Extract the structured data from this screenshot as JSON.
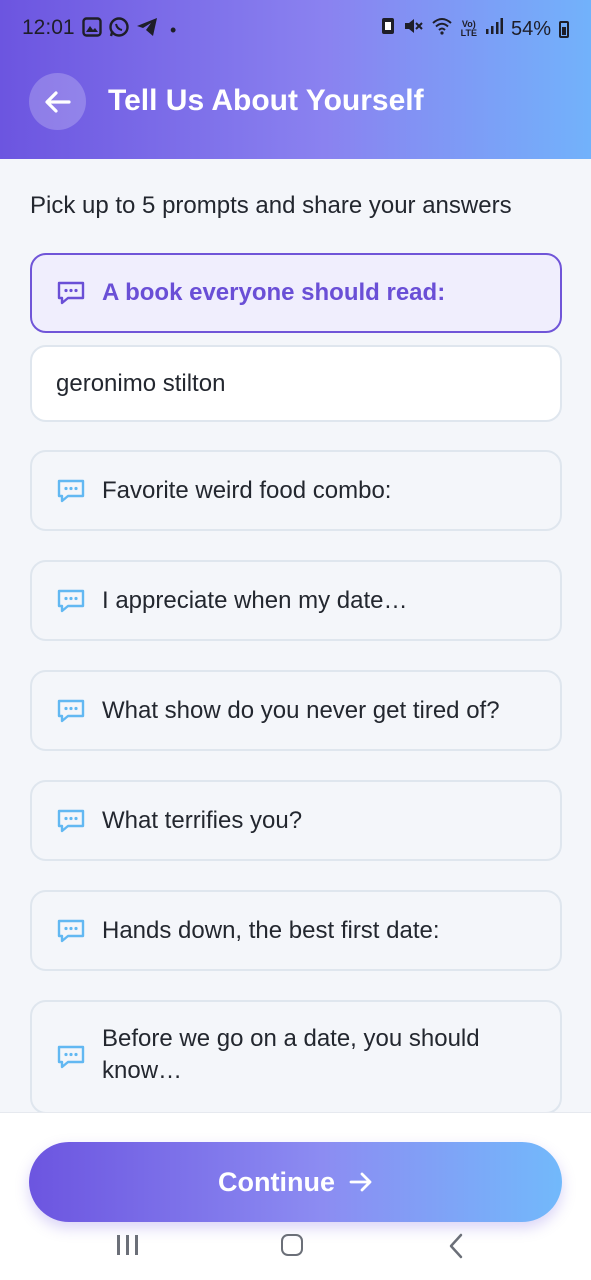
{
  "status_bar": {
    "time": "12:01",
    "dot": "•",
    "battery": "54%",
    "left_icons": [
      "gallery-icon",
      "whatsapp-icon",
      "telegram-icon"
    ],
    "right_icons": [
      "nfc-icon",
      "mute-icon",
      "wifi-icon",
      "volte-icon",
      "signal-icon",
      "battery-icon"
    ]
  },
  "header": {
    "title": "Tell Us About Yourself",
    "back_icon": "arrow-left-icon"
  },
  "subtitle": "Pick up to 5 prompts and share your answers",
  "prompts": [
    {
      "label": "A book everyone should read:",
      "selected": true
    },
    {
      "label": "Favorite weird food combo:",
      "selected": false
    },
    {
      "label": "I appreciate when my date…",
      "selected": false
    },
    {
      "label": "What show do you never get tired of?",
      "selected": false
    },
    {
      "label": "What terrifies you?",
      "selected": false
    },
    {
      "label": "Hands down, the best first date:",
      "selected": false
    },
    {
      "label": "Before we go on a date, you should know…",
      "selected": false
    }
  ],
  "answer": {
    "value": "geronimo stilton"
  },
  "continue": {
    "label": "Continue",
    "icon": "arrow-right-icon"
  },
  "colors": {
    "accent": "#6a4fd6",
    "gradient_start": "#6c55e0",
    "gradient_end": "#72b2fb",
    "icon_blue": "#62b8f2"
  }
}
